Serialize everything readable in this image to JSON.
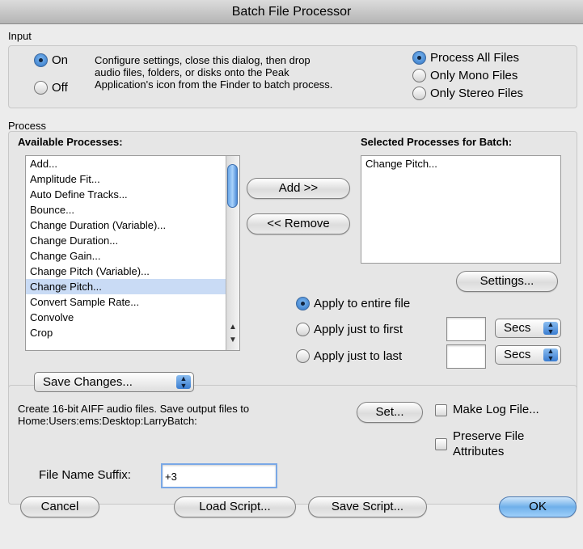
{
  "window": {
    "title": "Batch File Processor"
  },
  "input": {
    "label": "Input",
    "on_label": "On",
    "off_label": "Off",
    "description": [
      "Configure settings, close this dialog, then drop",
      "audio files, folders, or disks onto the Peak",
      "Application's icon from the Finder to batch process."
    ],
    "file_options": [
      "Process All Files",
      "Only Mono Files",
      "Only Stereo Files"
    ]
  },
  "process": {
    "label": "Process",
    "available_label": "Available Processes:",
    "available": [
      "Add...",
      "Amplitude Fit...",
      "Auto Define Tracks...",
      "Bounce...",
      "Change Duration (Variable)...",
      "Change Duration...",
      "Change Gain...",
      "Change Pitch (Variable)...",
      "Change Pitch...",
      "Convert Sample Rate...",
      "Convolve",
      "Crop"
    ],
    "selected_index": 8,
    "add_label": "Add >>",
    "remove_label": "<< Remove",
    "selected_label": "Selected Processes for Batch:",
    "selected": [
      "Change Pitch..."
    ],
    "settings_label": "Settings...",
    "apply_entire": "Apply to entire file",
    "apply_first": "Apply just to first",
    "apply_last": "Apply just to last",
    "first_value": "",
    "last_value": "",
    "first_unit": "Secs",
    "last_unit": "Secs"
  },
  "output": {
    "save_mode": "Save Changes...",
    "description": [
      "Create 16-bit AIFF audio files.  Save output files to",
      "Home:Users:ems:Desktop:LarryBatch:"
    ],
    "set_label": "Set...",
    "make_log": "Make Log File...",
    "preserve_attrs": [
      "Preserve File",
      "Attributes"
    ],
    "suffix_label": "File Name Suffix:",
    "suffix_value": "+3"
  },
  "footer": {
    "cancel": "Cancel",
    "load_script": "Load Script...",
    "save_script": "Save Script...",
    "ok": "OK"
  }
}
